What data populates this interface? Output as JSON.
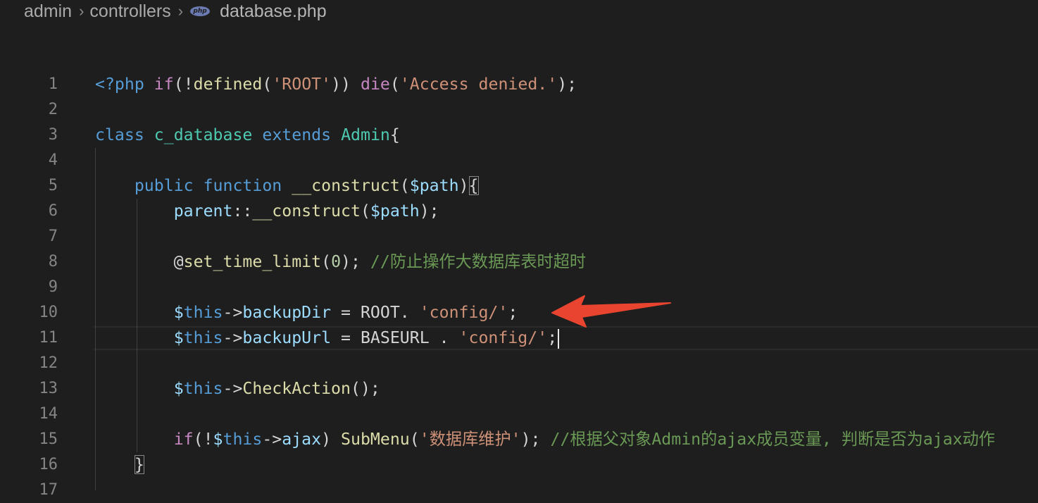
{
  "breadcrumb": {
    "segments": [
      "admin",
      "controllers"
    ],
    "file_icon_text": "php",
    "file": "database.php"
  },
  "editor": {
    "line_numbers": [
      "1",
      "2",
      "3",
      "4",
      "5",
      "6",
      "7",
      "8",
      "9",
      "10",
      "11",
      "12",
      "13",
      "14",
      "15",
      "16",
      "17"
    ],
    "lines": [
      [
        {
          "t": "<?php",
          "c": "kw"
        },
        {
          "t": " "
        },
        {
          "t": "if",
          "c": "ctl"
        },
        {
          "t": "(!"
        },
        {
          "t": "defined",
          "c": "fn"
        },
        {
          "t": "("
        },
        {
          "t": "'ROOT'",
          "c": "str"
        },
        {
          "t": ")) "
        },
        {
          "t": "die",
          "c": "ctl"
        },
        {
          "t": "("
        },
        {
          "t": "'Access denied.'",
          "c": "str"
        },
        {
          "t": ");"
        }
      ],
      [],
      [
        {
          "t": "class",
          "c": "kw"
        },
        {
          "t": " "
        },
        {
          "t": "c_database",
          "c": "cls"
        },
        {
          "t": " "
        },
        {
          "t": "extends",
          "c": "kw"
        },
        {
          "t": " "
        },
        {
          "t": "Admin",
          "c": "cls"
        },
        {
          "t": "{"
        }
      ],
      [],
      [
        {
          "t": "    "
        },
        {
          "t": "public",
          "c": "kw"
        },
        {
          "t": " "
        },
        {
          "t": "function",
          "c": "kw"
        },
        {
          "t": " "
        },
        {
          "t": "__construct",
          "c": "fn"
        },
        {
          "t": "("
        },
        {
          "t": "$path",
          "c": "var"
        },
        {
          "t": ")"
        },
        {
          "t": "{",
          "c": "brk"
        }
      ],
      [
        {
          "t": "        "
        },
        {
          "t": "parent",
          "c": "var"
        },
        {
          "t": "::"
        },
        {
          "t": "__construct",
          "c": "fn"
        },
        {
          "t": "("
        },
        {
          "t": "$path",
          "c": "var"
        },
        {
          "t": ");"
        }
      ],
      [],
      [
        {
          "t": "        @"
        },
        {
          "t": "set_time_limit",
          "c": "fn"
        },
        {
          "t": "("
        },
        {
          "t": "0",
          "c": "num"
        },
        {
          "t": "); "
        },
        {
          "t": "//防止操作大数据库表时超时",
          "c": "cmt"
        }
      ],
      [],
      [
        {
          "t": "        "
        },
        {
          "t": "$",
          "c": "var"
        },
        {
          "t": "this",
          "c": "kw"
        },
        {
          "t": "->"
        },
        {
          "t": "backupDir",
          "c": "var"
        },
        {
          "t": " = ROOT. "
        },
        {
          "t": "'config/'",
          "c": "str"
        },
        {
          "t": ";"
        }
      ],
      [
        {
          "t": "        "
        },
        {
          "t": "$",
          "c": "var"
        },
        {
          "t": "this",
          "c": "kw"
        },
        {
          "t": "->"
        },
        {
          "t": "backupUrl",
          "c": "var"
        },
        {
          "t": " = BASEURL . "
        },
        {
          "t": "'config/'",
          "c": "str"
        },
        {
          "t": ";"
        }
      ],
      [],
      [
        {
          "t": "        "
        },
        {
          "t": "$",
          "c": "var"
        },
        {
          "t": "this",
          "c": "kw"
        },
        {
          "t": "->"
        },
        {
          "t": "CheckAction",
          "c": "fn"
        },
        {
          "t": "();"
        }
      ],
      [],
      [
        {
          "t": "        "
        },
        {
          "t": "if",
          "c": "ctl"
        },
        {
          "t": "(!"
        },
        {
          "t": "$",
          "c": "var"
        },
        {
          "t": "this",
          "c": "kw"
        },
        {
          "t": "->"
        },
        {
          "t": "ajax",
          "c": "var"
        },
        {
          "t": ") "
        },
        {
          "t": "SubMenu",
          "c": "fn"
        },
        {
          "t": "("
        },
        {
          "t": "'数据库维护'",
          "c": "str"
        },
        {
          "t": "); "
        },
        {
          "t": "//根据父对象Admin的ajax成员变量, 判断是否为ajax动作",
          "c": "cmt"
        }
      ],
      [
        {
          "t": "    "
        },
        {
          "t": "}",
          "c": "brk"
        }
      ],
      []
    ],
    "active_line": 11,
    "cursor_line": 11
  },
  "colors": {
    "background": "#1e1e1e",
    "keyword": "#569cd6",
    "control": "#c586c0",
    "function": "#dcdcaa",
    "string": "#ce9178",
    "class": "#4ec9b0",
    "variable": "#9cdcfe",
    "comment": "#6a9955",
    "annotation_arrow": "#e8442f"
  },
  "annotation": {
    "type": "red-arrow-icon",
    "points_to_line": 10
  }
}
